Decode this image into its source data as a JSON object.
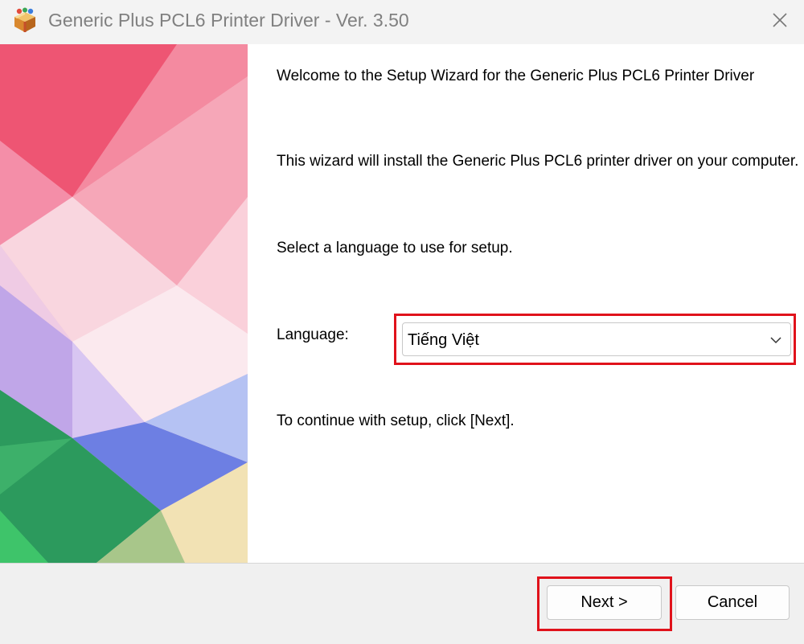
{
  "window": {
    "title": "Generic Plus PCL6 Printer Driver - Ver. 3.50",
    "app_icon": "installer-box-icon",
    "close_icon": "close-icon"
  },
  "content": {
    "welcome": "Welcome to the Setup Wizard for the Generic Plus PCL6 Printer Driver",
    "description": "This wizard will install the Generic Plus PCL6 printer driver on your computer.",
    "select_prompt": "Select a language to use for setup.",
    "language_label": "Language:",
    "language_value": "Tiếng Việt",
    "continue_text": "To continue with setup, click [Next]."
  },
  "buttons": {
    "next": "Next >",
    "cancel": "Cancel"
  },
  "colors": {
    "highlight": "#e0121b"
  }
}
